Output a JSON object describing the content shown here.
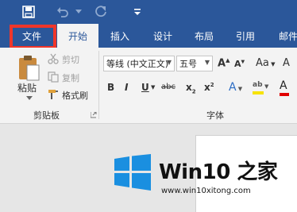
{
  "quick_access": {
    "save_icon": "save-icon",
    "undo_icon": "undo-icon",
    "undo_dropdown_icon": "chevron-down-icon",
    "redo_icon": "redo-icon",
    "customize_icon": "customize-qat-icon"
  },
  "tabs": [
    {
      "label": "文件"
    },
    {
      "label": "开始"
    },
    {
      "label": "插入"
    },
    {
      "label": "设计"
    },
    {
      "label": "布局"
    },
    {
      "label": "引用"
    },
    {
      "label": "邮件"
    }
  ],
  "clipboard": {
    "paste_label": "粘贴",
    "cut_label": "剪切",
    "copy_label": "复制",
    "format_painter_label": "格式刷",
    "group_label": "剪贴板"
  },
  "font": {
    "font_name": "等线 (中文正文)",
    "font_size": "五号",
    "grow_label": "A",
    "shrink_label": "A",
    "case_label": "Aa",
    "clear_label": "A",
    "bold_label": "B",
    "italic_label": "I",
    "underline_label": "U",
    "strike_label": "abc",
    "subscript_label": "x",
    "superscript_label": "x",
    "effects_label": "A",
    "highlight_label": "ab",
    "color_label": "A",
    "group_label": "字体",
    "highlight_color": "#f7e300",
    "font_color": "#e00000"
  },
  "watermark": {
    "title": "Win10 之家",
    "url": "www.win10xitong.com",
    "logo_color": "#1a8fe0"
  },
  "colors": {
    "accent": "#2b579a",
    "highlight_box": "#f0362a"
  }
}
